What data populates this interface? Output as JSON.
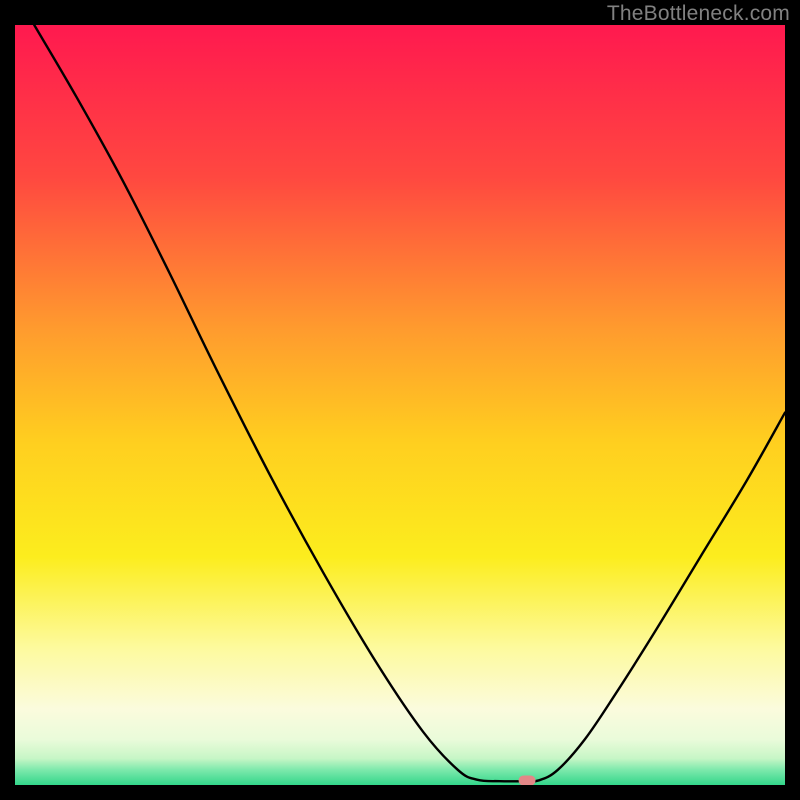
{
  "watermark": "TheBottleneck.com",
  "chart_data": {
    "type": "line",
    "title": "",
    "xlabel": "",
    "ylabel": "",
    "xlim": [
      0,
      100
    ],
    "ylim": [
      0,
      100
    ],
    "gradient_stops": [
      {
        "offset": 0,
        "color": "#ff194f"
      },
      {
        "offset": 20,
        "color": "#ff4840"
      },
      {
        "offset": 40,
        "color": "#ff9b2e"
      },
      {
        "offset": 55,
        "color": "#ffcf1f"
      },
      {
        "offset": 70,
        "color": "#fced1e"
      },
      {
        "offset": 82,
        "color": "#fdfa9e"
      },
      {
        "offset": 90,
        "color": "#fbfbdd"
      },
      {
        "offset": 94,
        "color": "#eafbda"
      },
      {
        "offset": 96.5,
        "color": "#c7f6c6"
      },
      {
        "offset": 98,
        "color": "#7de9ac"
      },
      {
        "offset": 100,
        "color": "#33d68a"
      }
    ],
    "series": [
      {
        "name": "bottleneck-curve",
        "points": [
          {
            "x": 2.5,
            "y": 100.0
          },
          {
            "x": 8.0,
            "y": 90.5
          },
          {
            "x": 14.0,
            "y": 79.5
          },
          {
            "x": 20.0,
            "y": 67.5
          },
          {
            "x": 26.0,
            "y": 55.0
          },
          {
            "x": 33.0,
            "y": 41.0
          },
          {
            "x": 40.0,
            "y": 28.0
          },
          {
            "x": 47.0,
            "y": 16.0
          },
          {
            "x": 53.0,
            "y": 7.0
          },
          {
            "x": 57.5,
            "y": 2.0
          },
          {
            "x": 60.0,
            "y": 0.7
          },
          {
            "x": 63.0,
            "y": 0.5
          },
          {
            "x": 66.0,
            "y": 0.5
          },
          {
            "x": 68.0,
            "y": 0.6
          },
          {
            "x": 70.5,
            "y": 2.0
          },
          {
            "x": 74.0,
            "y": 6.0
          },
          {
            "x": 78.0,
            "y": 12.0
          },
          {
            "x": 83.0,
            "y": 20.0
          },
          {
            "x": 89.0,
            "y": 30.0
          },
          {
            "x": 95.0,
            "y": 40.0
          },
          {
            "x": 100.0,
            "y": 49.0
          }
        ]
      }
    ],
    "marker": {
      "x": 66.5,
      "y": 0.6,
      "color": "#e38787"
    }
  }
}
